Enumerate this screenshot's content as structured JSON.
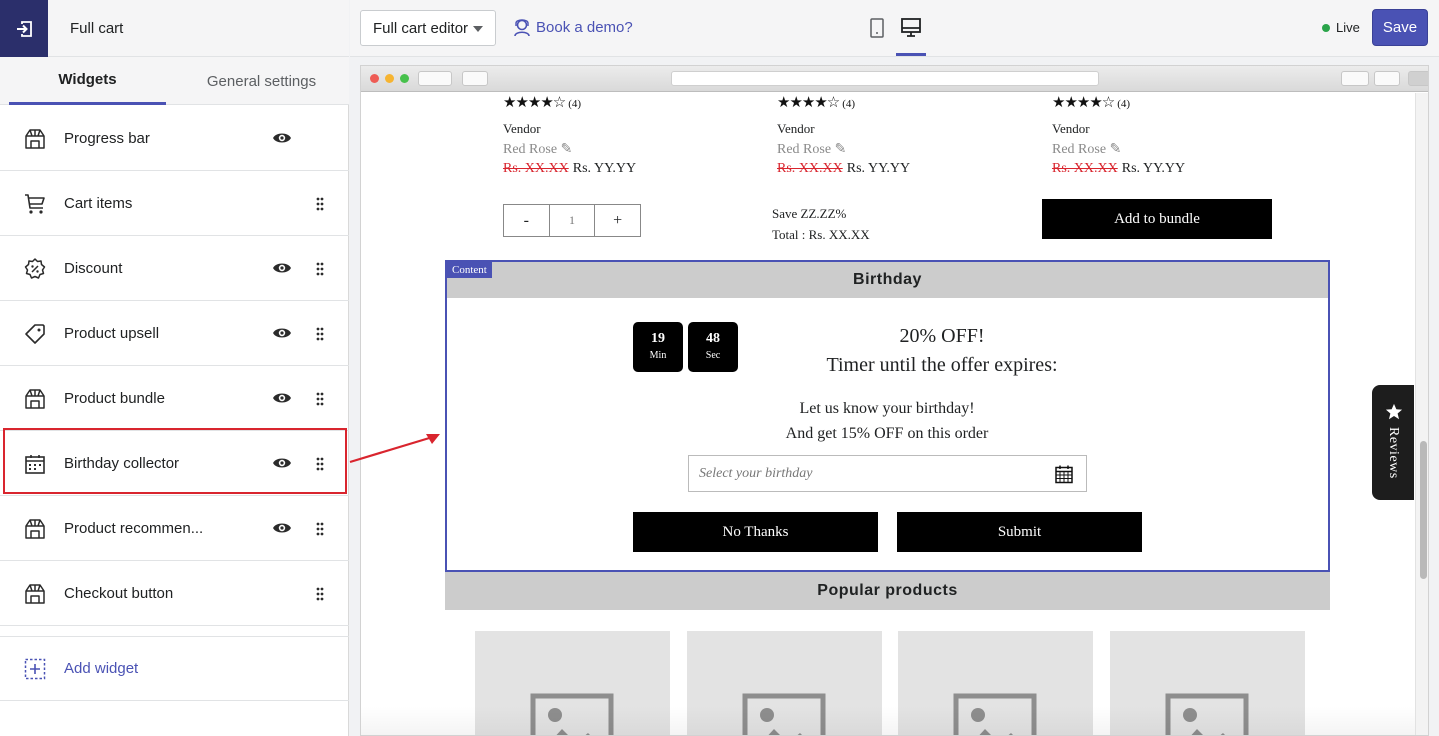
{
  "header": {
    "title": "Full cart"
  },
  "tabs": [
    {
      "label": "Widgets"
    },
    {
      "label": "General settings"
    }
  ],
  "widgets": [
    {
      "label": "Progress bar",
      "icon": "store-icon"
    },
    {
      "label": "Cart items",
      "icon": "cart-icon"
    },
    {
      "label": "Discount",
      "icon": "discount-icon"
    },
    {
      "label": "Product upsell",
      "icon": "tag-icon"
    },
    {
      "label": "Product bundle",
      "icon": "store-icon"
    },
    {
      "label": "Birthday collector",
      "icon": "calendar-icon"
    },
    {
      "label": "Product recommen...",
      "icon": "store-icon"
    },
    {
      "label": "Checkout button",
      "icon": "store-icon"
    }
  ],
  "add_widget": {
    "label": "Add widget"
  },
  "topbar": {
    "editor_select": "Full cart editor",
    "demo_link": "Book a demo?",
    "status": "Live",
    "save": "Save",
    "accent": "#4a52b4",
    "live_color": "#2aa44a"
  },
  "preview": {
    "products": [
      {
        "rating_count": "(4)",
        "vendor": "Vendor",
        "name": "Red Rose",
        "old_price": "Rs. XX.XX",
        "price": "Rs. YY.YY"
      },
      {
        "rating_count": "(4)",
        "vendor": "Vendor",
        "name": "Red Rose",
        "old_price": "Rs. XX.XX",
        "price": "Rs. YY.YY"
      },
      {
        "rating_count": "(4)",
        "vendor": "Vendor",
        "name": "Red Rose",
        "old_price": "Rs. XX.XX",
        "price": "Rs. YY.YY"
      }
    ],
    "qty": {
      "minus": "-",
      "value": "1",
      "plus": "+"
    },
    "save_line": "Save ZZ.ZZ%",
    "total_line": "Total : Rs. XX.XX",
    "bundle_button": "Add to bundle",
    "content_tag": "Content",
    "birthday": {
      "heading": "Birthday",
      "timer": [
        {
          "num": "19",
          "unit": "Min"
        },
        {
          "num": "48",
          "unit": "Sec"
        }
      ],
      "offer_line1": "20% OFF!",
      "offer_line2": "Timer until the offer expires:",
      "text_line1": "Let us know your birthday!",
      "text_line2": "And get 15% OFF on this order",
      "input_placeholder": "Select your birthday",
      "no_thanks": "No Thanks",
      "submit": "Submit"
    },
    "popular_heading": "Popular products",
    "reviews_tab": "Reviews"
  }
}
